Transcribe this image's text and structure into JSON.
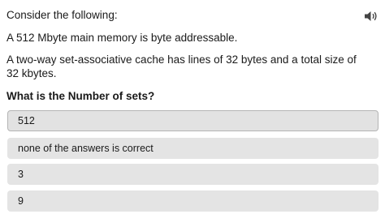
{
  "prompt": {
    "intro": "Consider the following:",
    "statement_1": "A 512 Mbyte main memory is byte addressable.",
    "statement_2": "A two-way set-associative cache has lines of 32 bytes and a total size of 32 kbytes.",
    "question": "What is the Number of sets?"
  },
  "audio": {
    "icon": "speaker-icon"
  },
  "options": [
    {
      "label": "512"
    },
    {
      "label": "none of the answers is correct"
    },
    {
      "label": "3"
    },
    {
      "label": "9"
    }
  ]
}
